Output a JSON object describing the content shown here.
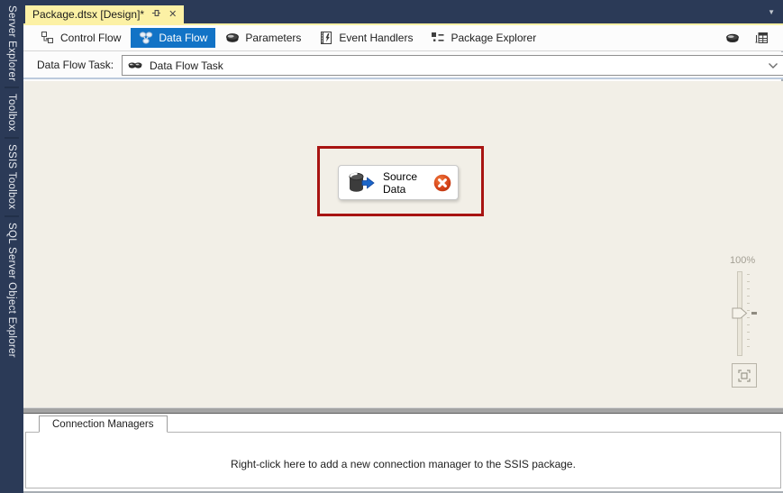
{
  "colors": {
    "accent_blue": "#1273c6",
    "active_tab_yellow": "#fcf1a5",
    "sidebar_navy": "#2b3a57",
    "canvas_beige": "#f2efe7",
    "annotation_red": "#a81412",
    "error_orange": "#d9481c"
  },
  "sidebar": {
    "items": [
      {
        "label": "Server Explorer"
      },
      {
        "label": "Toolbox"
      },
      {
        "label": "SSIS Toolbox"
      },
      {
        "label": "SQL Server Object Explorer"
      }
    ]
  },
  "tab_bar": {
    "active_tab": {
      "title": "Package.dtsx [Design]*",
      "pin_icon": "pin-icon",
      "close_glyph": "✕"
    },
    "overflow_glyph": "▼"
  },
  "toolbar": {
    "views": [
      {
        "label": "Control Flow",
        "icon": "control-flow-icon",
        "selected": false
      },
      {
        "label": "Data Flow",
        "icon": "data-flow-icon",
        "selected": true
      },
      {
        "label": "Parameters",
        "icon": "parameters-icon",
        "selected": false
      },
      {
        "label": "Event Handlers",
        "icon": "event-handlers-icon",
        "selected": false
      },
      {
        "label": "Package Explorer",
        "icon": "package-explorer-icon",
        "selected": false
      }
    ],
    "right_icons": [
      "package-icon",
      "variables-grid-icon"
    ]
  },
  "task_selector": {
    "label": "Data Flow Task:",
    "value": "Data Flow Task",
    "icon": "data-flow-task-icon"
  },
  "design_surface": {
    "component": {
      "label": "Source Data",
      "icon": "database-source-icon",
      "status_icon": "error-icon",
      "has_error": true
    },
    "annotation": "error-highlight-box",
    "zoom_control": {
      "level": "100%",
      "fit_button_icon": "fit-to-window-icon"
    }
  },
  "connection_managers": {
    "tab_label": "Connection Managers",
    "hint": "Right-click here to add a new connection manager to the SSIS package."
  }
}
